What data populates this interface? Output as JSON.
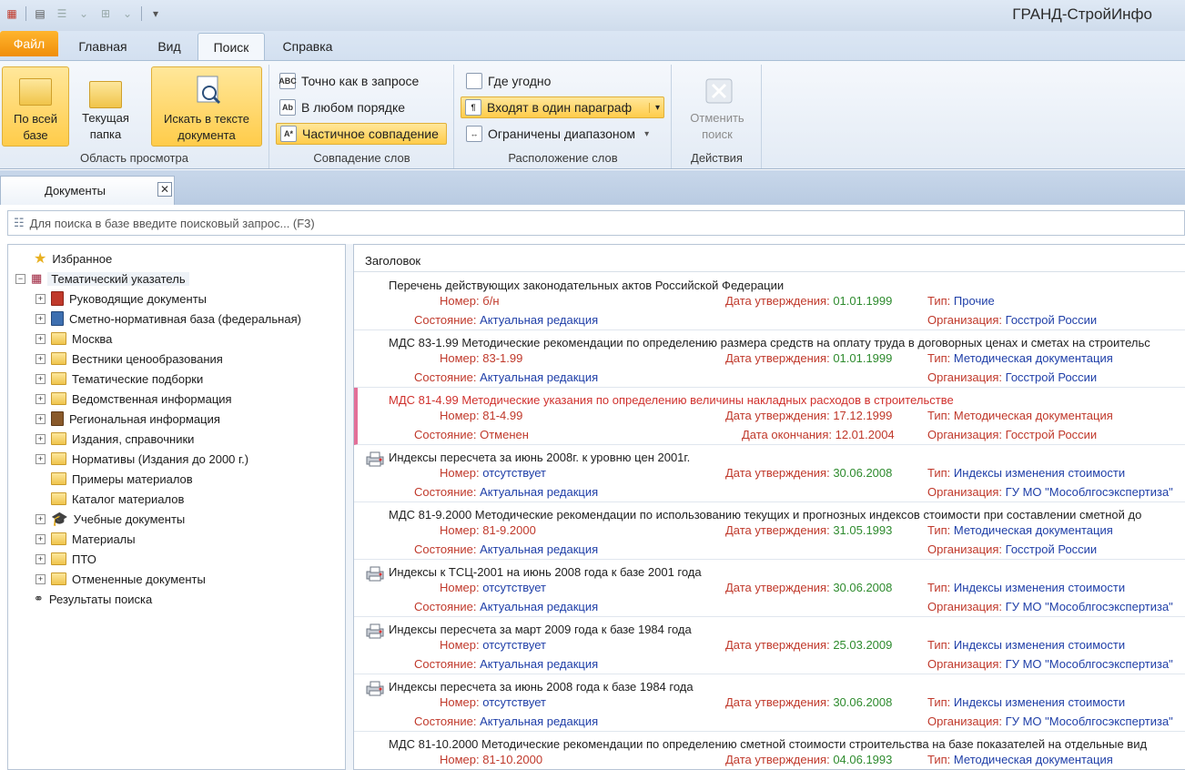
{
  "app": {
    "title": "ГРАНД-СтройИнфо"
  },
  "menu_tabs": [
    "Файл",
    "Главная",
    "Вид",
    "Поиск",
    "Справка"
  ],
  "ribbon": {
    "groups": {
      "view": {
        "label": "Область просмотра",
        "btn_all": "По всей\nбазе",
        "btn_folder": "Текущая\nпапка",
        "btn_text": "Искать в тексте\nдокумента"
      },
      "words": {
        "label": "Совпадение слов",
        "exact": "Точно как в запросе",
        "any_order": "В любом порядке",
        "partial": "Частичное совпадение"
      },
      "location": {
        "label": "Расположение слов",
        "anywhere": "Где угодно",
        "paragraph": "Входят в один параграф",
        "range": "Ограничены диапазоном"
      },
      "actions": {
        "label": "Действия",
        "cancel": "Отменить\nпоиск"
      }
    }
  },
  "doc_tab": "Документы",
  "search": {
    "placeholder": "Для поиска в базе введите поисковый запрос... (F3)"
  },
  "tree": [
    {
      "label": "Избранное"
    },
    {
      "label": "Тематический указатель"
    },
    {
      "label": "Руководящие документы"
    },
    {
      "label": "Сметно-нормативная база (федеральная)"
    },
    {
      "label": "Москва"
    },
    {
      "label": "Вестники ценообразования"
    },
    {
      "label": "Тематические подборки"
    },
    {
      "label": "Ведомственная информация"
    },
    {
      "label": "Региональная информация"
    },
    {
      "label": "Издания, справочники"
    },
    {
      "label": "Нормативы (Издания до 2000 г.)"
    },
    {
      "label": "Примеры материалов"
    },
    {
      "label": "Каталог материалов"
    },
    {
      "label": "Учебные документы"
    },
    {
      "label": "Материалы"
    },
    {
      "label": "ПТО"
    },
    {
      "label": "Отмененные документы"
    },
    {
      "label": "Результаты поиска"
    }
  ],
  "list": {
    "header": "Заголовок",
    "labels": {
      "number": "Номер:",
      "approved": "Дата утверждения:",
      "type": "Тип:",
      "state": "Состояние:",
      "org": "Организация:",
      "ended": "Дата окончания:"
    },
    "records": [
      {
        "title": "Перечень действующих законодательных актов Российской Федерации",
        "number": "б/н",
        "date": "01.01.1999",
        "type": "Прочие",
        "state": "Актуальная редакция",
        "org": "Госстрой России"
      },
      {
        "title": "МДС 83-1.99 Методические рекомендации по определению размера средств на оплату труда в договорных ценах и сметах на строительс",
        "number": "83-1.99",
        "date": "01.01.1999",
        "type": "Методическая документация",
        "state": "Актуальная редакция",
        "org": "Госстрой России"
      },
      {
        "title": "МДС 81-4.99 Методические указания по определению величины накладных расходов в строительстве",
        "number": "81-4.99",
        "date": "17.12.1999",
        "type": "Методическая документация",
        "state": "Отменен",
        "org": "Госстрой России",
        "ended": "12.01.2004"
      },
      {
        "title": "Индексы пересчета за июнь  2008г. к уровню цен 2001г.",
        "number": "отсутствует",
        "date": "30.06.2008",
        "type": "Индексы изменения стоимости",
        "state": "Актуальная редакция",
        "org": "ГУ МО \"Мособлгосэкспертиза\""
      },
      {
        "title": "МДС 81-9.2000 Методические рекомендации по использованию  текущих  и  прогнозных индексов стоимости при составлении сметной до",
        "number": "81-9.2000",
        "date": "31.05.1993",
        "type": "Методическая документация",
        "state": "Актуальная редакция",
        "org": "Госстрой России"
      },
      {
        "title": "Индексы к ТСЦ-2001 на июнь 2008 года к базе 2001 года",
        "number": "отсутствует",
        "date": "30.06.2008",
        "type": "Индексы изменения стоимости",
        "state": "Актуальная редакция",
        "org": "ГУ МО \"Мособлгосэкспертиза\""
      },
      {
        "title": "Индексы пересчета  за  март 2009 года к базе 1984 года",
        "number": "отсутствует",
        "date": "25.03.2009",
        "type": "Индексы изменения стоимости",
        "state": "Актуальная редакция",
        "org": "ГУ МО \"Мособлгосэкспертиза\""
      },
      {
        "title": " Индексы пересчета  за  июнь 2008 года к базе 1984 года",
        "number": "отсутствует",
        "date": "30.06.2008",
        "type": "Индексы изменения стоимости",
        "state": "Актуальная редакция",
        "org": "ГУ МО \"Мособлгосэкспертиза\""
      },
      {
        "title": "МДС 81-10.2000 Методические рекомендации по определению сметной стоимости строительства на базе показателей на отдельные вид",
        "number": "81-10.2000",
        "date": "04.06.1993",
        "type": "Методическая документация",
        "state": "",
        "org": ""
      }
    ]
  }
}
